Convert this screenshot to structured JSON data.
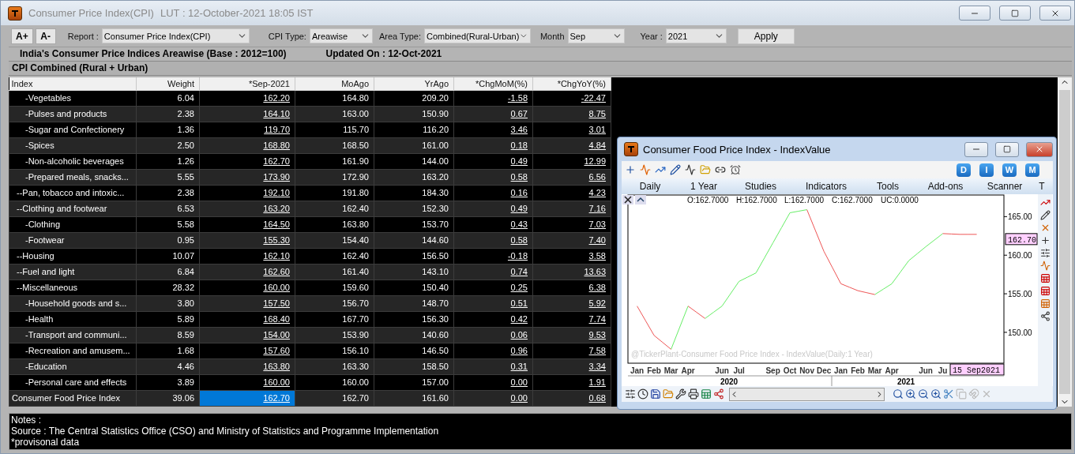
{
  "window": {
    "title": "Consumer Price Index(CPI)",
    "subtitle": "LUT : 12-October-2021 18:05 IST"
  },
  "toolbar": {
    "font_buttons": [
      "A+",
      "A-"
    ],
    "filters": [
      {
        "label": "Report :",
        "value": "Consumer Price Index(CPI)"
      },
      {
        "label": "CPI Type:",
        "value": "Areawise"
      },
      {
        "label": "Area Type:",
        "value": "Combined(Rural-Urban)"
      },
      {
        "label": "Month",
        "value": "Sep"
      },
      {
        "label": "Year :",
        "value": "2021"
      }
    ],
    "apply": "Apply"
  },
  "heading": {
    "title": "India's Consumer Price Indices Areawise (Base : 2012=100)",
    "updated": "Updated On : 12-Oct-2021"
  },
  "section": "CPI Combined (Rural + Urban)",
  "table": {
    "columns": [
      {
        "label": "Index",
        "link": false
      },
      {
        "label": "Weight",
        "link": false
      },
      {
        "label": "*Sep-2021",
        "link": true
      },
      {
        "label": "MoAgo",
        "link": false
      },
      {
        "label": "YrAgo",
        "link": false
      },
      {
        "label": "*ChgMoM(%)",
        "link": true
      },
      {
        "label": "*ChgYoY(%)",
        "link": true
      }
    ],
    "rows": [
      {
        "kind": "item",
        "selected": false,
        "cells": [
          "-Vegetables",
          "6.04",
          "162.20",
          "164.80",
          "209.20",
          "-1.58",
          "-22.47"
        ]
      },
      {
        "kind": "item",
        "selected": false,
        "cells": [
          "-Pulses and products",
          "2.38",
          "164.10",
          "163.00",
          "150.90",
          "0.67",
          "8.75"
        ]
      },
      {
        "kind": "item",
        "selected": false,
        "cells": [
          "-Sugar and Confectionery",
          "1.36",
          "119.70",
          "115.70",
          "116.20",
          "3.46",
          "3.01"
        ]
      },
      {
        "kind": "item",
        "selected": false,
        "cells": [
          "-Spices",
          "2.50",
          "168.80",
          "168.50",
          "161.00",
          "0.18",
          "4.84"
        ]
      },
      {
        "kind": "item",
        "selected": false,
        "cells": [
          "-Non-alcoholic beverages",
          "1.26",
          "162.70",
          "161.90",
          "144.00",
          "0.49",
          "12.99"
        ]
      },
      {
        "kind": "item",
        "selected": false,
        "cells": [
          "-Prepared meals, snacks...",
          "5.55",
          "173.90",
          "172.90",
          "163.20",
          "0.58",
          "6.56"
        ]
      },
      {
        "kind": "group",
        "selected": false,
        "cells": [
          "--Pan, tobacco and intoxic...",
          "2.38",
          "192.10",
          "191.80",
          "184.30",
          "0.16",
          "4.23"
        ]
      },
      {
        "kind": "group",
        "selected": false,
        "cells": [
          "--Clothing and footwear",
          "6.53",
          "163.20",
          "162.40",
          "152.30",
          "0.49",
          "7.16"
        ]
      },
      {
        "kind": "item",
        "selected": false,
        "cells": [
          "-Clothing",
          "5.58",
          "164.50",
          "163.80",
          "153.70",
          "0.43",
          "7.03"
        ]
      },
      {
        "kind": "item",
        "selected": false,
        "cells": [
          "-Footwear",
          "0.95",
          "155.30",
          "154.40",
          "144.60",
          "0.58",
          "7.40"
        ]
      },
      {
        "kind": "group",
        "selected": false,
        "cells": [
          "--Housing",
          "10.07",
          "162.10",
          "162.40",
          "156.50",
          "-0.18",
          "3.58"
        ]
      },
      {
        "kind": "group",
        "selected": false,
        "cells": [
          "--Fuel and light",
          "6.84",
          "162.60",
          "161.40",
          "143.10",
          "0.74",
          "13.63"
        ]
      },
      {
        "kind": "group",
        "selected": false,
        "cells": [
          "--Miscellaneous",
          "28.32",
          "160.00",
          "159.60",
          "150.40",
          "0.25",
          "6.38"
        ]
      },
      {
        "kind": "item",
        "selected": false,
        "cells": [
          "-Household goods and s...",
          "3.80",
          "157.50",
          "156.70",
          "148.70",
          "0.51",
          "5.92"
        ]
      },
      {
        "kind": "item",
        "selected": false,
        "cells": [
          "-Health",
          "5.89",
          "168.40",
          "167.70",
          "156.30",
          "0.42",
          "7.74"
        ]
      },
      {
        "kind": "item",
        "selected": false,
        "cells": [
          "-Transport and communi...",
          "8.59",
          "154.00",
          "153.90",
          "140.60",
          "0.06",
          "9.53"
        ]
      },
      {
        "kind": "item",
        "selected": false,
        "cells": [
          "-Recreation and amusem...",
          "1.68",
          "157.60",
          "156.10",
          "146.50",
          "0.96",
          "7.58"
        ]
      },
      {
        "kind": "item",
        "selected": false,
        "cells": [
          "-Education",
          "4.46",
          "163.80",
          "163.30",
          "158.50",
          "0.31",
          "3.34"
        ]
      },
      {
        "kind": "item",
        "selected": false,
        "cells": [
          "-Personal care and effects",
          "3.89",
          "160.00",
          "160.00",
          "157.00",
          "0.00",
          "1.91"
        ]
      },
      {
        "kind": "total",
        "selected": true,
        "cells": [
          "Consumer Food Price Index",
          "39.06",
          "162.70",
          "162.70",
          "161.60",
          "0.00",
          "0.68"
        ]
      }
    ]
  },
  "notes": [
    "Notes :",
    "Source : The Central Statistics Office (CSO) and Ministry of Statistics and Programme Implementation",
    "*provisonal data"
  ],
  "chart_window": {
    "title": "Consumer Food Price Index - IndexValue",
    "period_buttons": [
      "D",
      "I",
      "W",
      "M"
    ],
    "menu": [
      "Daily",
      "1 Year",
      "Studies",
      "Indicators",
      "Tools",
      "Add-ons",
      "Scanner",
      "T"
    ],
    "ohlc": [
      "O:162.7000",
      "H:162.7000",
      "L:162.7000",
      "C:162.7000",
      "UC:0.0000"
    ],
    "caption": "@TickerPlant-Consumer Food Price Index - IndexValue(Daily:1 Year)",
    "price_tag": "162.70",
    "cursor_date": "15 Sep2021",
    "years": [
      "2020",
      "2021"
    ],
    "chart_data": {
      "type": "line",
      "categories": [
        "Jan",
        null,
        "Feb",
        null,
        "Mar",
        null,
        "Apr",
        null,
        null,
        null,
        "Jun",
        null,
        "Jul",
        null,
        null,
        null,
        "Sep",
        null,
        "Oct",
        null,
        "Nov",
        null,
        "Dec",
        null,
        "Jan",
        null,
        "Feb",
        null,
        "Mar",
        null,
        "Apr",
        null,
        null,
        null,
        "Jun",
        null,
        "Ju",
        null,
        null,
        null,
        null
      ],
      "series": [
        {
          "color": "#66ee66",
          "values": [
            null,
            null,
            null,
            null,
            147.8,
            150.6,
            153.4,
            null,
            151.8,
            152.6,
            153.4,
            155,
            156.6,
            157.15,
            157.7,
            159.65,
            161.6,
            163.55,
            165.5,
            165.7,
            165.9,
            null,
            null,
            null,
            null,
            null,
            null,
            null,
            154.9,
            155.6,
            156.3,
            157.8,
            159.3,
            160.2,
            161.1,
            161.95,
            162.8,
            null,
            null,
            null,
            null
          ]
        },
        {
          "color": "#ee5555",
          "values": [
            153.4,
            151.5,
            149.6,
            148.7,
            147.8,
            null,
            153.4,
            152.6,
            151.8,
            null,
            null,
            null,
            null,
            null,
            null,
            null,
            null,
            null,
            null,
            null,
            165.9,
            163.2,
            160.5,
            158.4,
            156.3,
            155.85,
            155.4,
            155.15,
            154.9,
            null,
            null,
            null,
            null,
            null,
            null,
            null,
            162.8,
            162.75,
            162.7,
            162.7,
            162.7
          ]
        }
      ],
      "ylim": [
        146,
        167.8
      ],
      "yticks": [
        {
          "value": 150,
          "label": "150.00"
        },
        {
          "value": 155,
          "label": "155.00"
        },
        {
          "value": 160,
          "label": "160.00"
        },
        {
          "value": 165,
          "label": "165.00"
        }
      ]
    }
  }
}
